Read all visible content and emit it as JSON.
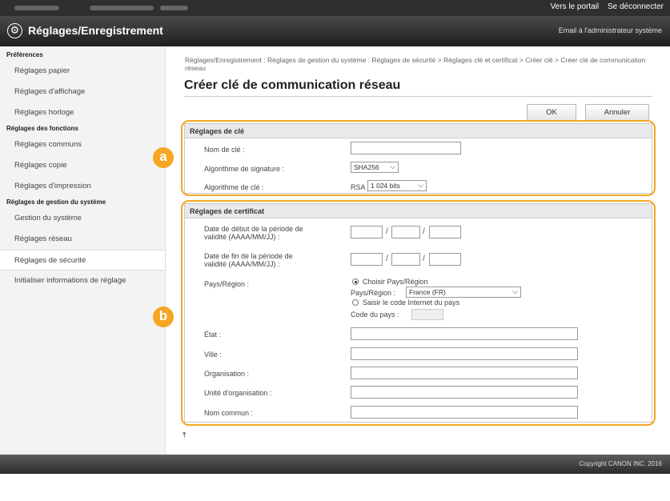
{
  "topbar": {
    "portal_link": "Vers le portail",
    "logout_link": "Se déconnecter"
  },
  "header": {
    "title": "Réglages/Enregistrement",
    "mail_admin": "Email à l'administrateur système"
  },
  "sidebar": {
    "sections": [
      {
        "heading": "Préférences",
        "items": [
          "Réglages papier",
          "Réglages d'affichage",
          "Réglages horloge"
        ]
      },
      {
        "heading": "Réglages des fonctions",
        "items": [
          "Réglages communs",
          "Réglages copie",
          "Réglages d'impression"
        ]
      },
      {
        "heading": "Réglages de gestion du système",
        "items": [
          "Gestion du système",
          "Réglages réseau",
          "Réglages de sécurité",
          "Initialiser informations de réglage"
        ]
      }
    ],
    "active_item": "Réglages de sécurité"
  },
  "main": {
    "breadcrumb": "Réglages/Enregistrement : Réglages de gestion du système : Réglages de sécurité > Réglages clé et certificat > Créer clé > Créer clé de communication réseau",
    "title": "Créer clé de communication réseau",
    "ok_label": "OK",
    "cancel_label": "Annuler"
  },
  "key_settings": {
    "heading": "Réglages de clé",
    "key_name_label": "Nom de clé :",
    "key_name_value": "",
    "sig_algo_label": "Algorithme de signature :",
    "sig_algo_value": "SHA256",
    "key_algo_label": "Algorithme de clé :",
    "key_algo_prefix": "RSA",
    "key_algo_value": "1 024 bits"
  },
  "cert_settings": {
    "heading": "Réglages de certificat",
    "start_date_label": "Date de début de la période de validité (AAAA/MM/JJ) :",
    "end_date_label": "Date de fin de la période de validité (AAAA/MM/JJ) :",
    "country_label": "Pays/Région :",
    "radio_choose": "Choisir Pays/Région",
    "country_select_label": "Pays/Région :",
    "country_value": "France (FR)",
    "radio_code": "Saisir le code Internet du pays",
    "country_code_label": "Code du pays :",
    "state_label": "État :",
    "city_label": "Ville :",
    "org_label": "Organisation :",
    "org_unit_label": "Unité d'organisation :",
    "common_name_label": "Nom commun :"
  },
  "markers": {
    "a": "a",
    "b": "b"
  },
  "footer": {
    "copyright": "Copyright CANON INC. 2016"
  },
  "colors": {
    "highlight": "#f6a623",
    "header_bg": "#2f2f2f"
  }
}
